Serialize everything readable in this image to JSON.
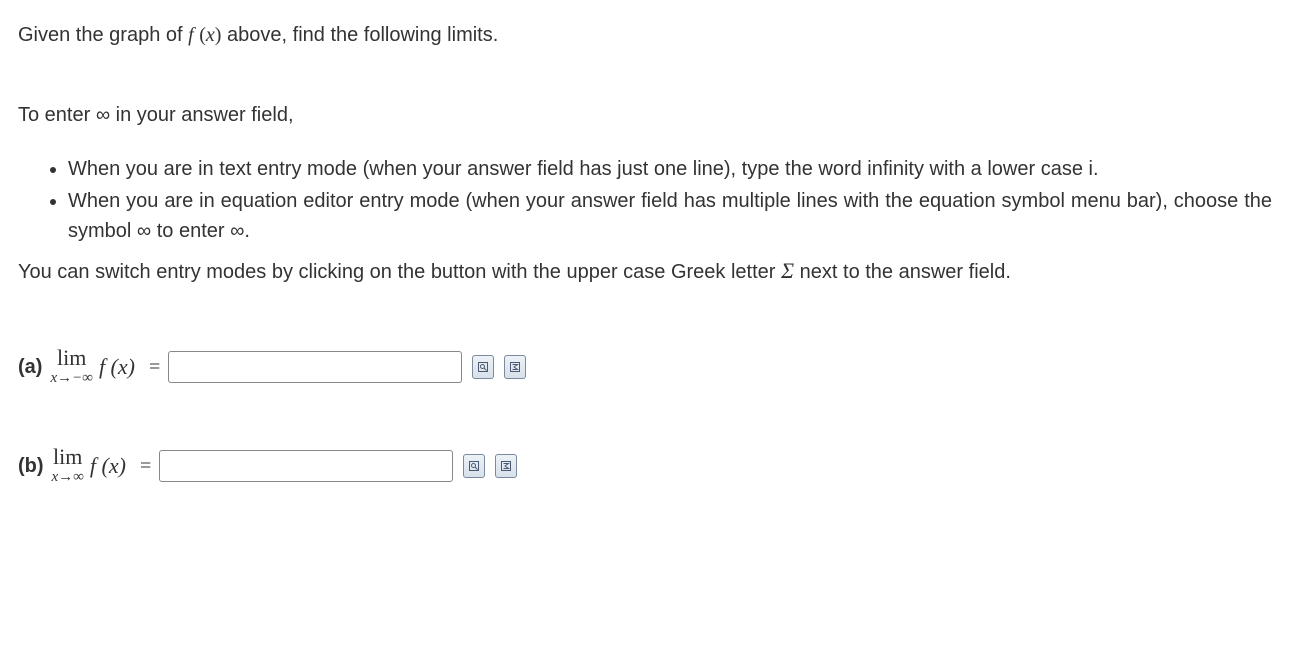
{
  "intro": "Given the graph of f (x) above, find the following limits.",
  "instructions_lead": "To enter ∞ in your answer field,",
  "bullets": [
    "When you are in text entry mode (when your answer field has just one line), type the word infinity with a lower case i.",
    "When you are in equation editor entry mode (when your answer field has multiple lines with the equation symbol menu bar), choose the symbol ∞ to enter ∞."
  ],
  "note_pre": "You can switch entry modes by clicking on the button with the upper case Greek letter ",
  "note_sigma": "Σ",
  "note_post": "  next to the answer field.",
  "questions": [
    {
      "label": "(a)",
      "lim_top": "lim",
      "lim_bot": "x→−∞",
      "fn": "f (x)",
      "eq": "=",
      "value": ""
    },
    {
      "label": "(b)",
      "lim_top": "lim",
      "lim_bot": "x→∞",
      "fn": "f (x)",
      "eq": "=",
      "value": ""
    }
  ],
  "icons": {
    "preview": "preview-icon",
    "eqeditor": "equation-editor-icon"
  }
}
